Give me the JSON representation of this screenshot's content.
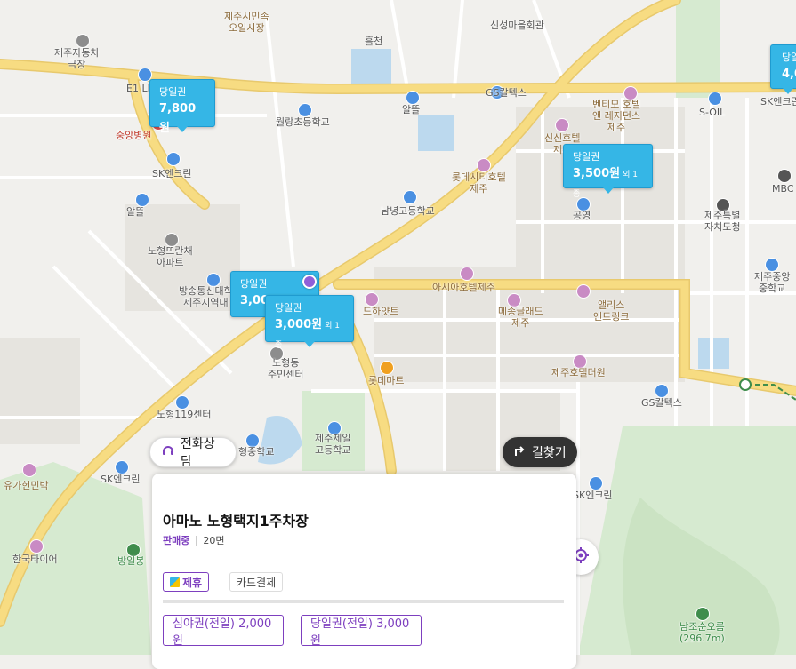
{
  "map": {
    "poi_labels": [
      {
        "name": "poi-jeju-market",
        "text": "제주시민속\n오일시장",
        "style": "brown"
      },
      {
        "name": "poi-heukcheon",
        "text": "흘천",
        "style": ""
      },
      {
        "name": "poi-sinseong-hall",
        "text": "신성마을회관",
        "style": ""
      },
      {
        "name": "poi-bus-garage",
        "text": "제주자동차\n극장",
        "style": ""
      },
      {
        "name": "poi-e1",
        "text": "E1 LI",
        "style": ""
      },
      {
        "name": "poi-gs-1",
        "text": "GS칼텍스",
        "style": ""
      },
      {
        "name": "poi-jungang-hospital",
        "text": "중앙병원",
        "style": "red"
      },
      {
        "name": "poi-wolrang-school",
        "text": "월랑초등학교",
        "style": ""
      },
      {
        "name": "poi-altteul-1",
        "text": "알뜰",
        "style": ""
      },
      {
        "name": "poi-ventimo-hotel",
        "text": "벤티모 호텔\n앤 레지던스\n제주",
        "style": "brown"
      },
      {
        "name": "poi-s-oil",
        "text": "S-OIL",
        "style": ""
      },
      {
        "name": "poi-sk-1",
        "text": "SK엔크린",
        "style": ""
      },
      {
        "name": "poi-shinshin-hotel",
        "text": "신신호텔\n제주",
        "style": "brown"
      },
      {
        "name": "poi-sk-2",
        "text": "SK엔크린",
        "style": ""
      },
      {
        "name": "poi-lotte-hotel",
        "text": "롯데시티호텔\n제주",
        "style": "brown"
      },
      {
        "name": "poi-mbc",
        "text": "MBC",
        "style": ""
      },
      {
        "name": "poi-altteul-2",
        "text": "알뜰",
        "style": ""
      },
      {
        "name": "poi-namnyeong-school",
        "text": "남녕고등학교",
        "style": ""
      },
      {
        "name": "poi-gongyeong",
        "text": "공영",
        "style": ""
      },
      {
        "name": "poi-jeju-office",
        "text": "제주특별\n자치도청",
        "style": ""
      },
      {
        "name": "poi-nohyeong-apt",
        "text": "노형뜨란채\n아파트",
        "style": ""
      },
      {
        "name": "poi-broadcast-univ",
        "text": "방송통신대학\n제주지역대",
        "style": ""
      },
      {
        "name": "poi-asia-hotel",
        "text": "아시아호텔제주",
        "style": "brown"
      },
      {
        "name": "poi-jeju-middle",
        "text": "제주중앙\n중학교",
        "style": ""
      },
      {
        "name": "poi-hyatt",
        "text": "드하얏트",
        "style": "brown"
      },
      {
        "name": "poi-mezon-glad",
        "text": "메종글래드\n제주",
        "style": "brown"
      },
      {
        "name": "poi-alice",
        "text": "앨리스\n앤트링크",
        "style": "brown"
      },
      {
        "name": "poi-nohyeong-center",
        "text": "노형동\n주민센터",
        "style": ""
      },
      {
        "name": "poi-lotte-mart",
        "text": "롯데마트",
        "style": "brown"
      },
      {
        "name": "poi-jeju-hotel-the-one",
        "text": "제주호텔더원",
        "style": "brown"
      },
      {
        "name": "poi-gs-2",
        "text": "GS칼텍스",
        "style": ""
      },
      {
        "name": "poi-nohyeong-119",
        "text": "노형119센터",
        "style": ""
      },
      {
        "name": "poi-jeil-high",
        "text": "제주제일\n고등학교",
        "style": ""
      },
      {
        "name": "poi-nohyeong-middle",
        "text": "형중학교",
        "style": ""
      },
      {
        "name": "poi-yuga-museum",
        "text": "유가헌민박",
        "style": "brown"
      },
      {
        "name": "poi-sk-3",
        "text": "SK엔크린",
        "style": ""
      },
      {
        "name": "poi-sk-4",
        "text": "SK엔크린",
        "style": ""
      },
      {
        "name": "poi-hankook-tire",
        "text": "한국타이어",
        "style": ""
      },
      {
        "name": "poi-bangilbong",
        "text": "방일봉",
        "style": "green"
      },
      {
        "name": "poi-namjosun",
        "text": "남조순오름\n(296.7m)",
        "style": "green"
      }
    ]
  },
  "markers": [
    {
      "type": "당일권",
      "price": "7,800원",
      "extra": ""
    },
    {
      "type": "당일권",
      "price": "3,500원",
      "extra": "외 1종"
    },
    {
      "type": "당일권",
      "price": "3,00",
      "extra": ""
    },
    {
      "type": "당일권",
      "price": "3,000원",
      "extra": "외 1종"
    },
    {
      "type": "당일",
      "price": "4,0",
      "extra": ""
    }
  ],
  "buttons": {
    "call": "전화상담",
    "directions": "길찾기"
  },
  "card": {
    "title": "아마노 노형택지1주차장",
    "status": "판매중",
    "spaces": "20면",
    "partner_tag": "제휴",
    "card_tag": "카드결제",
    "tickets": [
      "심야권(전일) 2,000원",
      "당일권(전일) 3,000원"
    ]
  },
  "colors": {
    "accent": "#7d3fbf",
    "marker": "#35b6e6",
    "road": "#f7dc82",
    "road_border": "#e8c96d"
  }
}
